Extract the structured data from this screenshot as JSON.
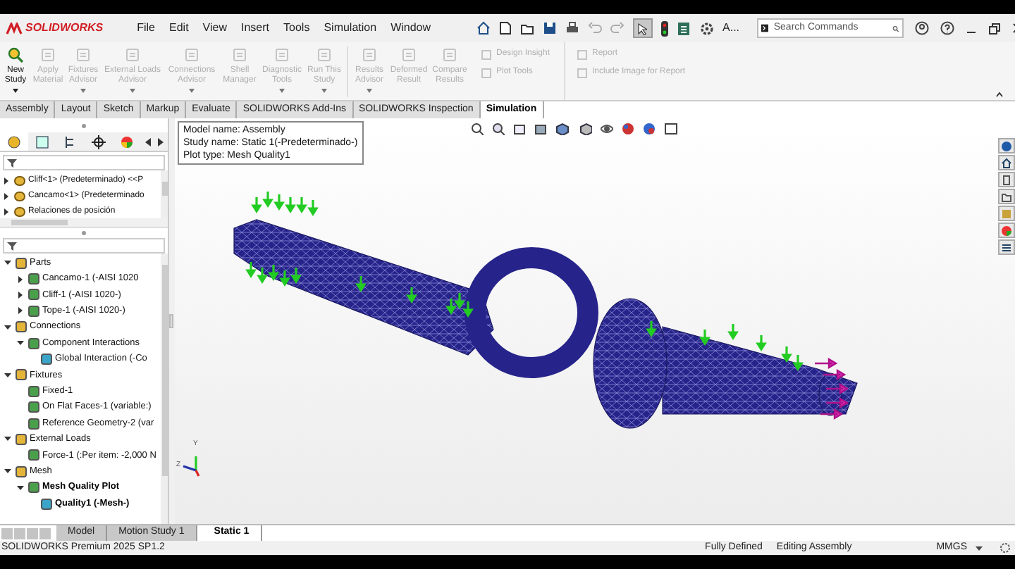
{
  "app": {
    "logo": "SOLIDWORKS"
  },
  "menu": [
    "File",
    "Edit",
    "View",
    "Insert",
    "Tools",
    "Simulation",
    "Window"
  ],
  "quick_toolbar": {
    "label": "A...",
    "search": {
      "placeholder": "Search Commands"
    }
  },
  "ribbon": {
    "buttons": [
      {
        "label": "New\nStudy",
        "disabled": false,
        "has_menu": true
      },
      {
        "label": "Apply\nMaterial",
        "disabled": true,
        "has_menu": false
      },
      {
        "label": "Fixtures\nAdvisor",
        "disabled": true,
        "has_menu": true
      },
      {
        "label": "External Loads\nAdvisor",
        "disabled": true,
        "has_menu": true
      },
      {
        "label": "Connections\nAdvisor",
        "disabled": true,
        "has_menu": true
      },
      {
        "label": "Shell\nManager",
        "disabled": true,
        "has_menu": false
      },
      {
        "label": "Diagnostic\nTools",
        "disabled": true,
        "has_menu": true
      },
      {
        "label": "Run This\nStudy",
        "disabled": true,
        "has_menu": true
      },
      {
        "label": "Results\nAdvisor",
        "disabled": true,
        "has_menu": true
      },
      {
        "label": "Deformed\nResult",
        "disabled": true,
        "has_menu": false
      },
      {
        "label": "Compare\nResults",
        "disabled": true,
        "has_menu": false
      }
    ],
    "small_items": [
      {
        "label": "Design Insight",
        "disabled": true
      },
      {
        "label": "Plot Tools",
        "disabled": true
      }
    ],
    "report_items": [
      {
        "label": "Report",
        "disabled": true
      },
      {
        "label": "Include Image for Report",
        "disabled": true
      }
    ]
  },
  "command_tabs": [
    {
      "label": "Assembly",
      "selected": false
    },
    {
      "label": "Layout",
      "selected": false
    },
    {
      "label": "Sketch",
      "selected": false
    },
    {
      "label": "Markup",
      "selected": false
    },
    {
      "label": "Evaluate",
      "selected": false
    },
    {
      "label": "SOLIDWORKS Add-Ins",
      "selected": false
    },
    {
      "label": "SOLIDWORKS Inspection",
      "selected": false
    },
    {
      "label": "Simulation",
      "selected": true
    }
  ],
  "feature_tree": {
    "items": [
      {
        "label": "Cliff<1> (Predeterminado) <<P",
        "expanded": false
      },
      {
        "label": "Cancamo<1> (Predeterminado",
        "expanded": false
      },
      {
        "label": "Relaciones de posición",
        "expanded": false
      }
    ]
  },
  "study_tree": {
    "items": [
      {
        "label": "Parts",
        "expanded": true,
        "active": false,
        "children": [
          {
            "label": "Cancamo-1 (-AISI 1020",
            "expanded": false,
            "active": false
          },
          {
            "label": "Cliff-1 (-AISI 1020-)",
            "expanded": false,
            "active": false
          },
          {
            "label": "Tope-1 (-AISI 1020-)",
            "expanded": false,
            "active": false
          }
        ]
      },
      {
        "label": "Connections",
        "expanded": true,
        "active": false,
        "children": [
          {
            "label": "Component Interactions",
            "expanded": true,
            "active": false,
            "children": [
              {
                "label": "Global Interaction (-Co",
                "active": false
              }
            ]
          }
        ]
      },
      {
        "label": "Fixtures",
        "expanded": true,
        "active": false,
        "children": [
          {
            "label": "Fixed-1",
            "active": false
          },
          {
            "label": "On Flat Faces-1 (variable:)",
            "active": false
          },
          {
            "label": "Reference Geometry-2 (var",
            "active": false
          }
        ]
      },
      {
        "label": "External Loads",
        "expanded": true,
        "active": false,
        "children": [
          {
            "label": "Force-1 (:Per item: -2,000 N",
            "active": false
          }
        ]
      },
      {
        "label": "Mesh",
        "expanded": true,
        "active": false,
        "children": [
          {
            "label": "Mesh Quality Plot",
            "expanded": true,
            "active": true,
            "children": [
              {
                "label": "Quality1 (-Mesh-)",
                "active": true
              }
            ]
          }
        ]
      }
    ]
  },
  "viewport": {
    "info": [
      "Model name: Assembly",
      "Study name: Static 1(-Predeterminado-)",
      "Plot type: Mesh Quality1"
    ],
    "triad": {
      "y": "Y",
      "z": "Z"
    }
  },
  "bottom_tabs": [
    {
      "label": "Model",
      "selected": false
    },
    {
      "label": "Motion Study 1",
      "selected": false
    },
    {
      "label": "Static 1",
      "selected": true
    }
  ],
  "status_bar": {
    "product": "SOLIDWORKS Premium 2025 SP1.2",
    "state": "Fully Defined",
    "mode": "Editing Assembly",
    "units": "MMGS"
  }
}
